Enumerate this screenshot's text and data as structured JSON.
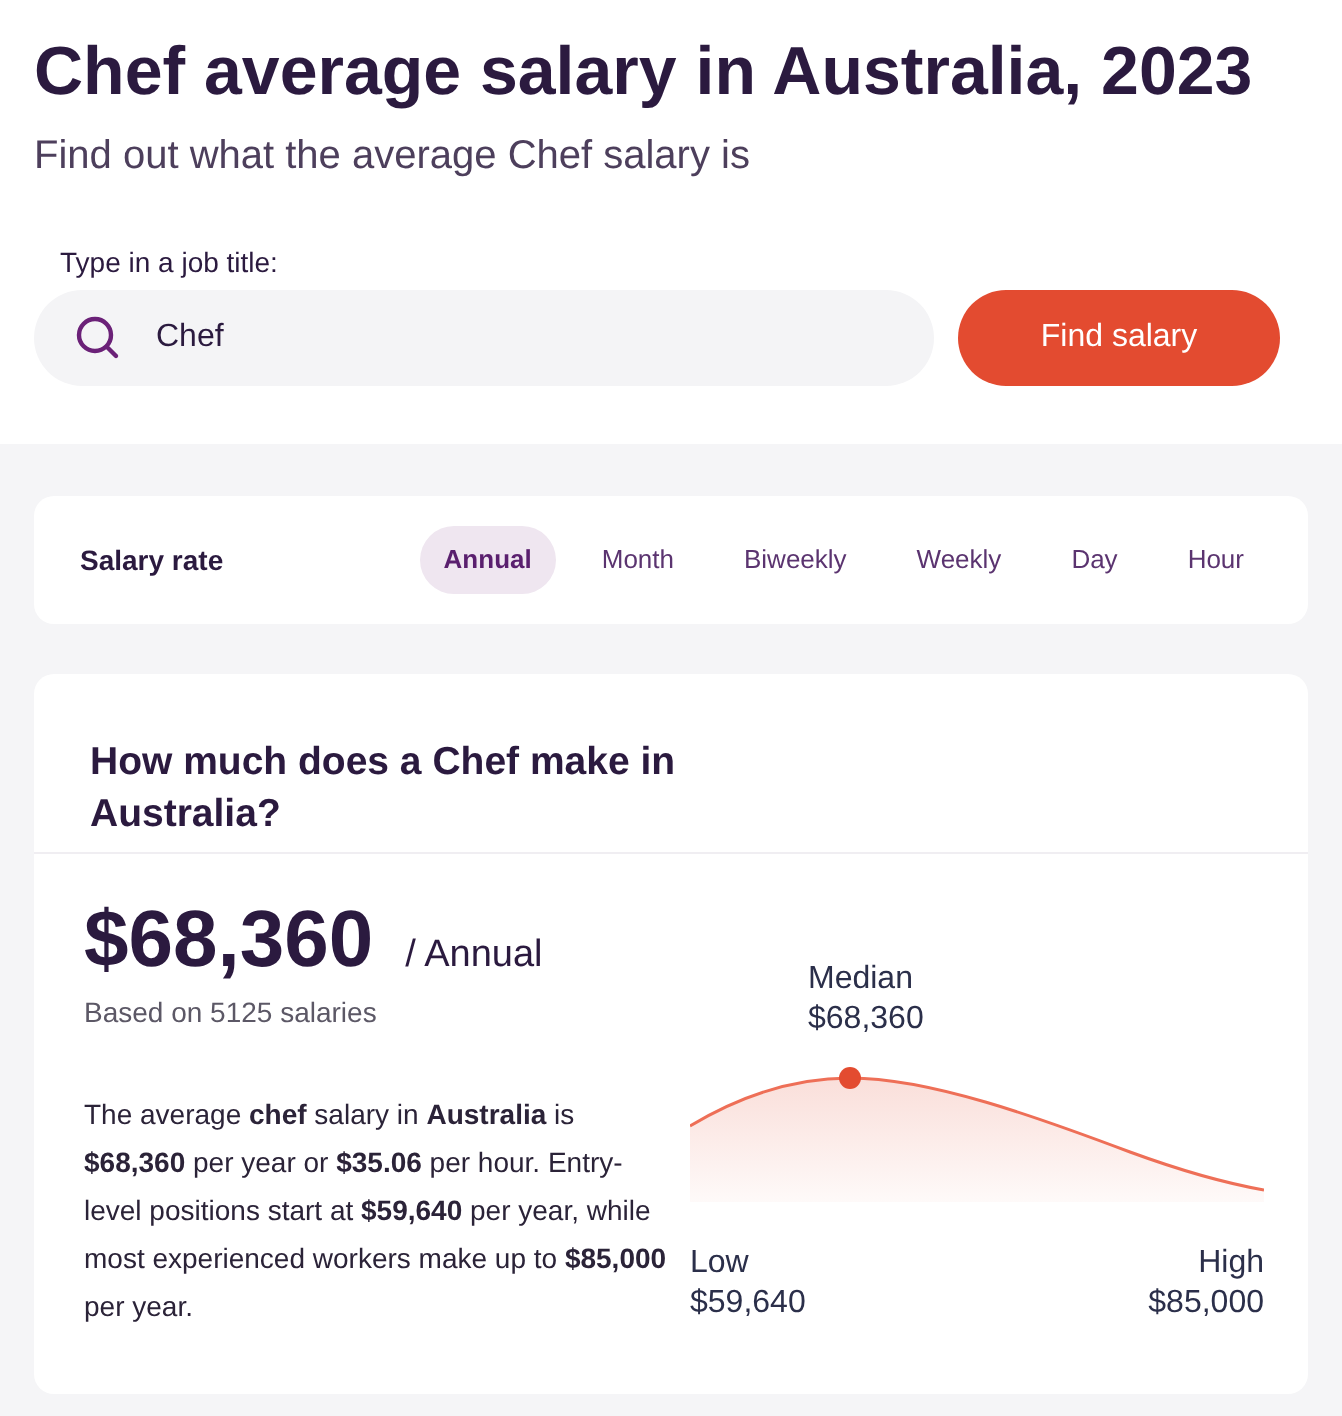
{
  "page": {
    "title": "Chef average salary in Australia, 2023",
    "subtitle": "Find out what the average Chef salary is"
  },
  "search": {
    "label": "Type in a job title:",
    "value": "Chef",
    "button": "Find salary"
  },
  "salary_rate": {
    "label": "Salary rate",
    "tabs": [
      {
        "label": "Annual",
        "selected": true
      },
      {
        "label": "Month",
        "selected": false
      },
      {
        "label": "Biweekly",
        "selected": false
      },
      {
        "label": "Weekly",
        "selected": false
      },
      {
        "label": "Day",
        "selected": false
      },
      {
        "label": "Hour",
        "selected": false
      }
    ]
  },
  "summary": {
    "heading": "How much does a Chef make in Australia?",
    "amount": "$68,360",
    "unit": "/ Annual",
    "basis": "Based on 5125 salaries",
    "description": "The average **chef** salary in **Australia** is **$68,360** per year or **$35.06** per hour. Entry-level positions start at **$59,640** per year, while most experienced workers make up to **$85,000** per year."
  },
  "distribution": {
    "median": {
      "label": "Median",
      "value": "$68,360"
    },
    "low": {
      "label": "Low",
      "value": "$59,640"
    },
    "high": {
      "label": "High",
      "value": "$85,000"
    }
  }
}
